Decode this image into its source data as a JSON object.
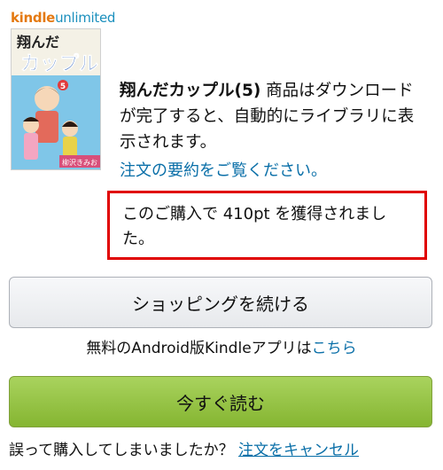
{
  "logo": {
    "kindle": "kindle",
    "unlimited": "unlimited"
  },
  "cover": {
    "title_line1": "翔んだ",
    "title_line2": "カップル",
    "volume": "5",
    "author": "柳沢きみお"
  },
  "message": {
    "title": "翔んだカップル(5)",
    "body": " 商品はダウンロードが完了すると、自動的にライブラリに表示されます。"
  },
  "order_summary_link": "注文の要約をご覧ください。",
  "points_notice": "このご購入で 410pt を獲得されました。",
  "continue_button": "ショッピングを続ける",
  "android": {
    "prefix": "無料のAndroid版Kindleアプリは",
    "link": "こちら"
  },
  "read_button": "今すぐ読む",
  "cancel": {
    "prefix": "誤って購入してしまいましたか？ ",
    "link": "注文をキャンセル"
  }
}
